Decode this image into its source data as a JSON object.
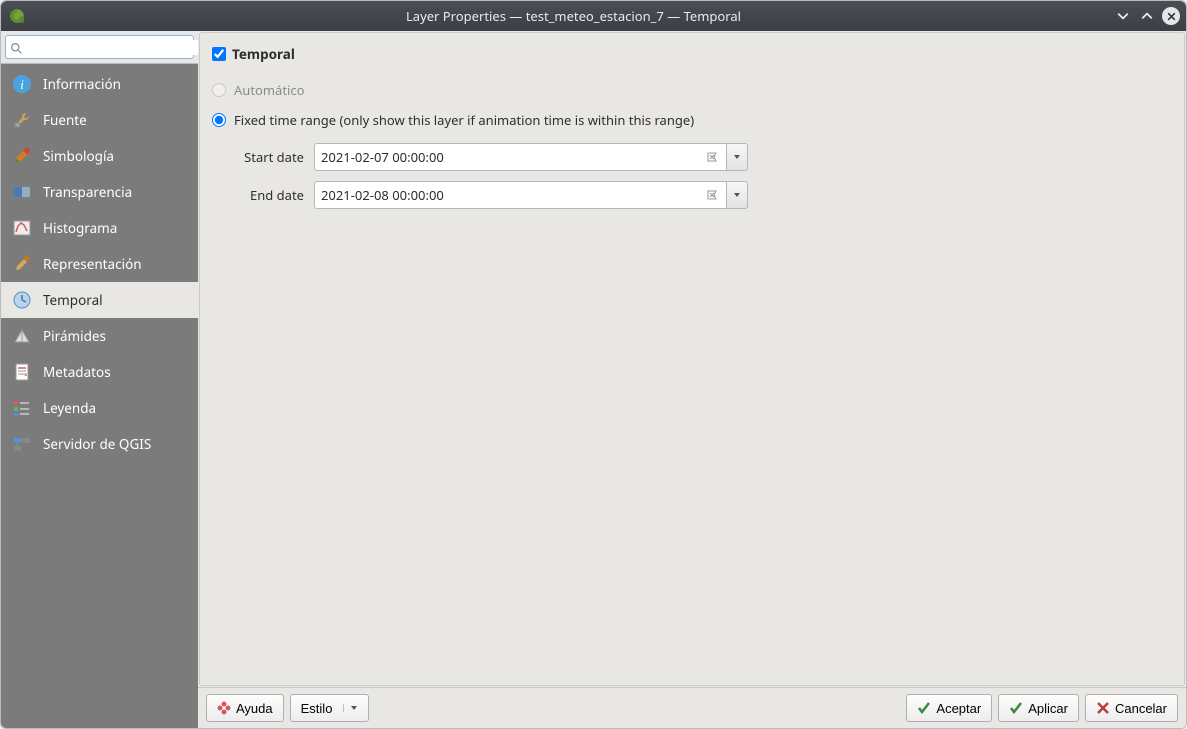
{
  "window": {
    "title": "Layer Properties — test_meteo_estacion_7 — Temporal"
  },
  "sidebar": {
    "search_value": "",
    "items": [
      {
        "label": "Información",
        "key": "info"
      },
      {
        "label": "Fuente",
        "key": "source"
      },
      {
        "label": "Simbología",
        "key": "symbology"
      },
      {
        "label": "Transparencia",
        "key": "transparency"
      },
      {
        "label": "Histograma",
        "key": "histogram"
      },
      {
        "label": "Representación",
        "key": "render"
      },
      {
        "label": "Temporal",
        "key": "temporal"
      },
      {
        "label": "Pirámides",
        "key": "pyramids"
      },
      {
        "label": "Metadatos",
        "key": "metadata"
      },
      {
        "label": "Leyenda",
        "key": "legend"
      },
      {
        "label": "Servidor de QGIS",
        "key": "server"
      }
    ],
    "selected_key": "temporal"
  },
  "temporal": {
    "section_label": "Temporal",
    "enabled": true,
    "mode_auto_label": "Automático",
    "mode_fixed_label": "Fixed time range (only show this layer if animation time is within this range)",
    "mode": "fixed",
    "start_label": "Start date",
    "start_value": "2021-02-07 00:00:00",
    "end_label": "End date",
    "end_value": "2021-02-08 00:00:00"
  },
  "footer": {
    "help": "Ayuda",
    "style": "Estilo",
    "ok": "Aceptar",
    "apply": "Aplicar",
    "cancel": "Cancelar"
  }
}
